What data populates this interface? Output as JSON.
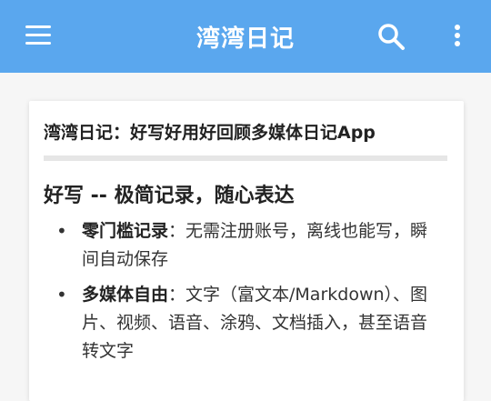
{
  "appbar": {
    "title": "湾湾日记",
    "icons": {
      "menu": "menu-icon",
      "search": "search-icon",
      "more": "more-vert-icon"
    },
    "background": "#5aa7ee"
  },
  "article": {
    "title": "湾湾日记：好写好用好回顾多媒体日记App",
    "section_heading": "好写 -- 极简记录，随心表达",
    "bullets": [
      {
        "bold": "零门槛记录",
        "text": "：无需注册账号，离线也能写，瞬间自动保存"
      },
      {
        "bold": "多媒体自由",
        "text": "：文字（富文本/Markdown）、图片、视频、语音、涂鸦、文档插入，甚至语音转文字"
      }
    ]
  }
}
